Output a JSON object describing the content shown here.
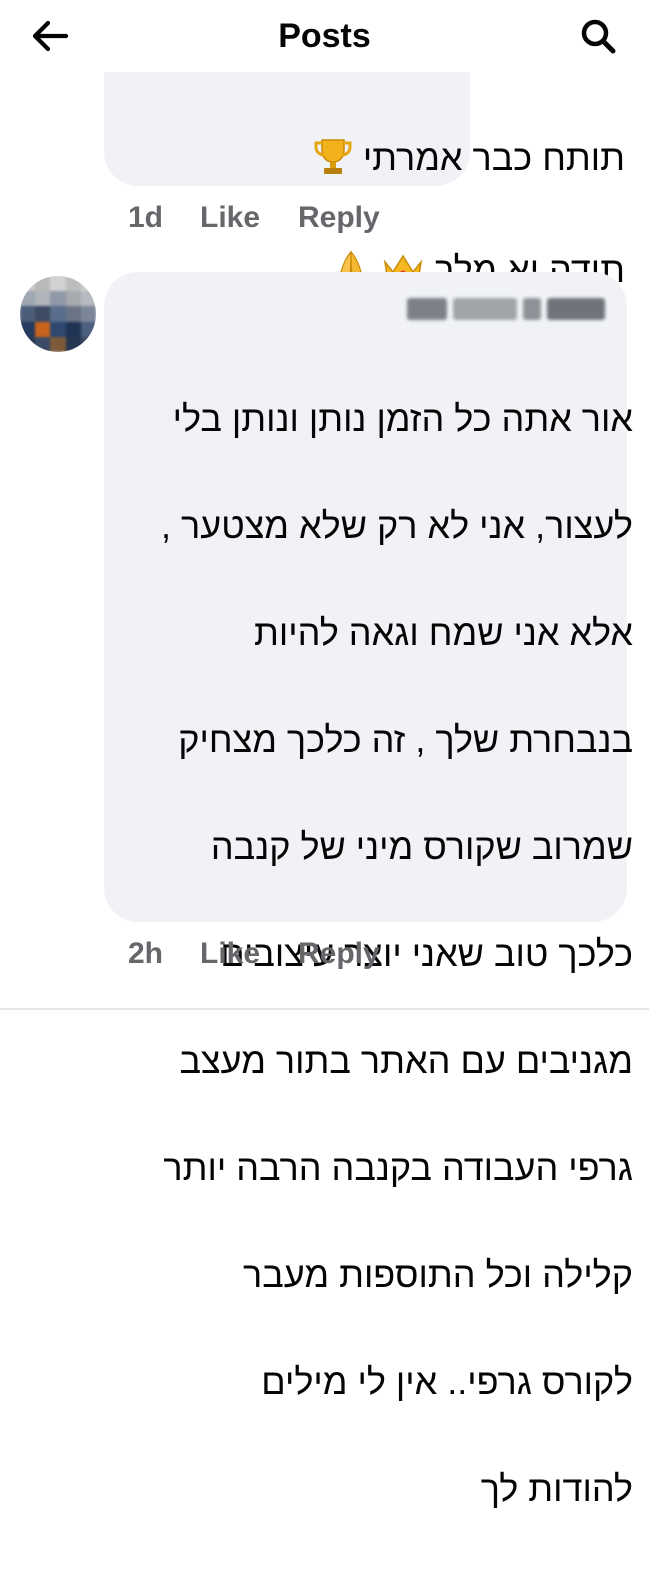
{
  "header": {
    "title": "Posts",
    "back_icon": "arrow-left-icon",
    "search_icon": "search-icon"
  },
  "comments": [
    {
      "author": "",
      "lines": [
        "תותח כבר אמרתי",
        "תודה יא מלך"
      ],
      "emoji": [
        "trophy",
        "crown",
        "folded-hands"
      ],
      "time": "1d",
      "like_label": "Like",
      "reply_label": "Reply"
    },
    {
      "author": "",
      "lines": [
        "אור אתה כל הזמן נותן ונותן בלי",
        "לעצור, אני לא רק שלא מצטער ,",
        "אלא אני שמח וגאה להיות",
        "בנבחרת שלך , זה כלכך מצחיק",
        "שמרוב שקורס מיני של קנבה",
        "כלכך טוב שאני יוצר עיצובים",
        "מגניבים עם האתר בתור מעצב",
        "גרפי העבודה בקנבה הרבה יותר",
        "קלילה וכל התוספות מעבר",
        "לקורס גרפי.. אין לי מילים",
        "להודות לך"
      ],
      "time": "2h",
      "like_label": "Like",
      "reply_label": "Reply"
    }
  ],
  "colors": {
    "bubble": "#f0f2f5",
    "meta_text": "#65676b",
    "text": "#050505"
  }
}
